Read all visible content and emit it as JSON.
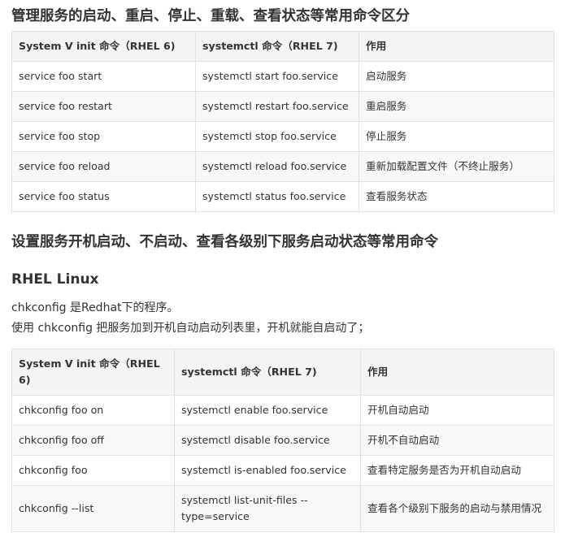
{
  "section1": {
    "heading": "管理服务的启动、重启、停止、重载、查看状态等常用命令区分",
    "table": {
      "headers": [
        "System V init 命令（RHEL 6)",
        "systemctl 命令（RHEL 7)",
        "作用"
      ],
      "rows": [
        [
          "service foo start",
          "systemctl start foo.service",
          "启动服务"
        ],
        [
          "service foo restart",
          "systemctl restart foo.service",
          "重启服务"
        ],
        [
          "service foo stop",
          "systemctl stop foo.service",
          "停止服务"
        ],
        [
          "service foo reload",
          "systemctl reload foo.service",
          "重新加载配置文件（不终止服务）"
        ],
        [
          "service foo status",
          "systemctl status foo.service",
          "查看服务状态"
        ]
      ]
    }
  },
  "section2": {
    "heading": "设置服务开机启动、不启动、查看各级别下服务启动状态等常用命令",
    "subheading": "RHEL Linux",
    "paragraphs": [
      "chkconfig 是Redhat下的程序。",
      "使用 chkconfig 把服务加到开机自动启动列表里，开机就能自启动了；"
    ],
    "table": {
      "headers": [
        "System V init 命令（RHEL 6)",
        "systemctl 命令（RHEL 7)",
        "作用"
      ],
      "rows": [
        [
          "chkconfig foo on",
          "systemctl enable foo.service",
          "开机自动启动"
        ],
        [
          "chkconfig foo off",
          "systemctl disable foo.service",
          "开机不自动启动"
        ],
        [
          "chkconfig foo",
          "systemctl is-enabled foo.service",
          "查看特定服务是否为开机自动启动"
        ],
        [
          "chkconfig --list",
          "systemctl list-unit-files --type=service",
          "查看各个级别下服务的启动与禁用情况"
        ]
      ]
    }
  }
}
